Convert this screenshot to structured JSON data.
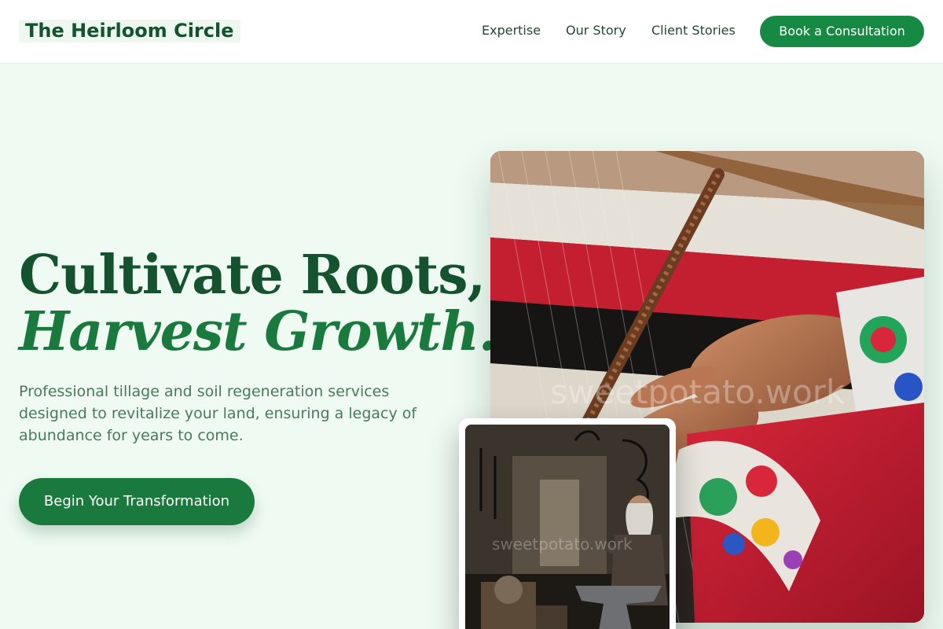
{
  "header": {
    "brand": "The Heirloom Circle",
    "nav": [
      "Expertise",
      "Our Story",
      "Client Stories"
    ],
    "cta_label": "Book a Consultation"
  },
  "hero": {
    "headline_line1": "Cultivate Roots,",
    "headline_line2": "Harvest Growth.",
    "description": "Professional tillage and soil regeneration services designed to revitalize your land, ensuring a legacy of abundance for years to come.",
    "cta_label": "Begin Your Transformation"
  },
  "images": {
    "main_watermark": "sweetpotato.work",
    "small_watermark": "sweetpotato.work"
  },
  "colors": {
    "brand_green": "#14532d",
    "accent_green": "#1a7a3d",
    "button_green": "#168a42",
    "page_background": "#effaf2"
  }
}
